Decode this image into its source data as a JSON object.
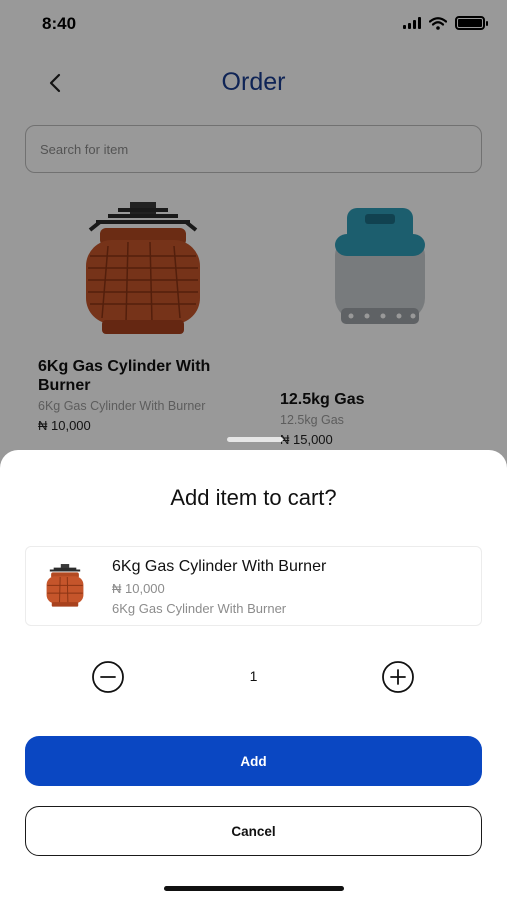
{
  "status_bar": {
    "time": "8:40"
  },
  "header": {
    "title": "Order",
    "back_icon": "chevron-left-icon"
  },
  "search": {
    "placeholder": "Search for item",
    "value": ""
  },
  "products": [
    {
      "title": "6Kg Gas Cylinder With Burner",
      "description": "6Kg Gas Cylinder With Burner",
      "price": "₦ 10,000",
      "image": "orange-gas-cylinder-with-burner"
    },
    {
      "title": "12.5kg Gas",
      "description": "12.5kg Gas",
      "price": "₦ 15,000",
      "image": "blue-grey-gas-cylinder"
    }
  ],
  "sheet": {
    "title": "Add item to cart?",
    "item": {
      "name": "6Kg Gas Cylinder With Burner",
      "price": "₦ 10,000",
      "description": "6Kg Gas Cylinder With Burner"
    },
    "quantity": "1",
    "add_label": "Add",
    "cancel_label": "Cancel"
  },
  "colors": {
    "title_blue": "#1a3d8f",
    "primary_button": "#0a47c2",
    "overlay": "rgba(0,0,0,0.40)",
    "muted_text": "#8c8c8c",
    "cylinder_orange": "#c5552b",
    "cylinder_teal": "#2f9db8"
  }
}
